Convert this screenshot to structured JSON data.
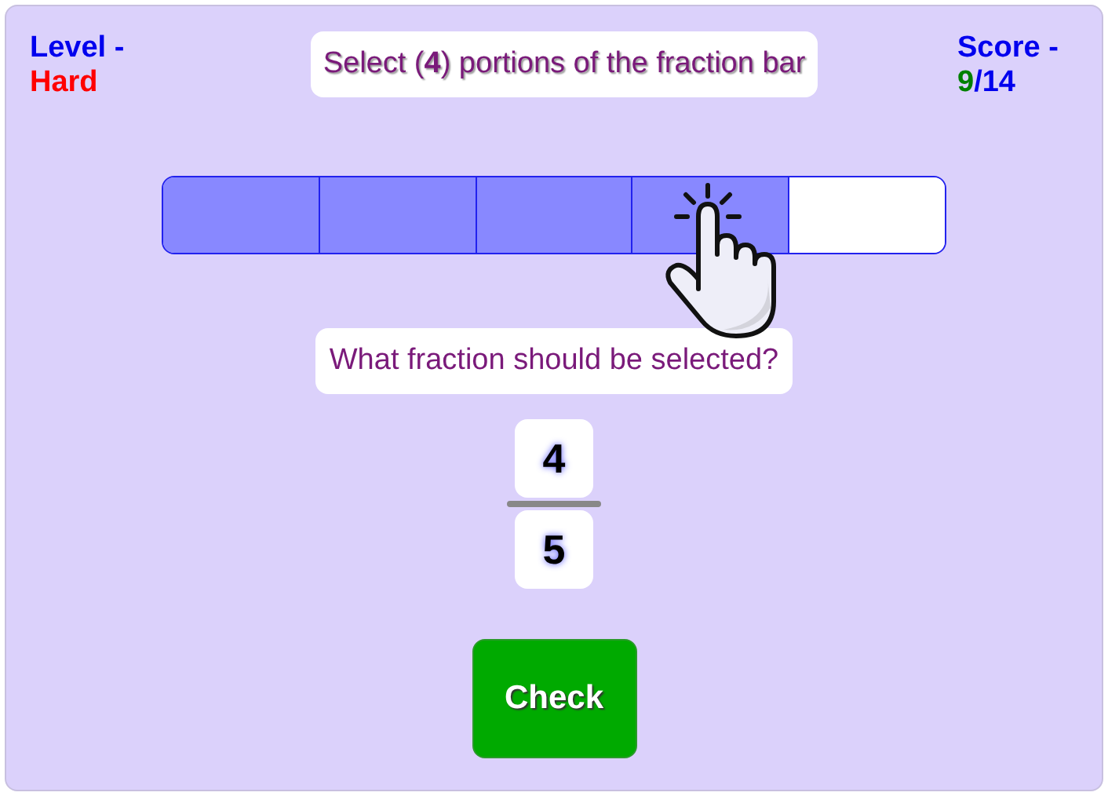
{
  "level": {
    "label": "Level -",
    "value": "Hard"
  },
  "instruction": "Select (**4**) portions of the fraction bar",
  "score": {
    "label": "Score -",
    "correct": "9",
    "total": "/14"
  },
  "fraction_bar": [
    {
      "selected": true
    },
    {
      "selected": true
    },
    {
      "selected": true
    },
    {
      "selected": true
    },
    {
      "selected": false
    }
  ],
  "question": "What fraction should be selected?",
  "fraction": {
    "numerator": "4",
    "denominator": "5"
  },
  "check_button": "Check"
}
